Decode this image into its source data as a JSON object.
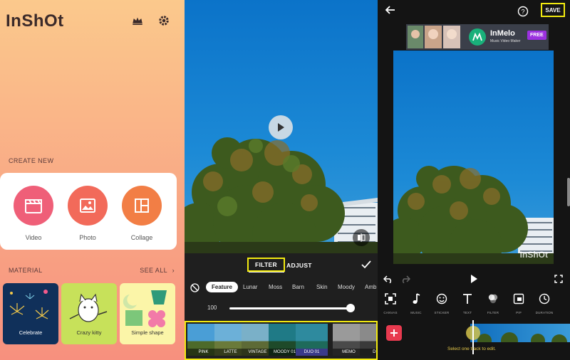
{
  "home": {
    "logo": "InShOt",
    "create_new_title": "CREATE NEW",
    "create_items": [
      {
        "label": "Video",
        "icon": "clapperboard-icon"
      },
      {
        "label": "Photo",
        "icon": "image-icon"
      },
      {
        "label": "Collage",
        "icon": "collage-icon"
      }
    ],
    "material_title": "MATERIAL",
    "see_all": "SEE ALL",
    "materials": [
      {
        "label": "Celebrate"
      },
      {
        "label": "Crazy kitty"
      },
      {
        "label": "Simple shape"
      }
    ]
  },
  "filter_editor": {
    "tabs": [
      "FILTER",
      "ADJUST"
    ],
    "categories": [
      "Feature",
      "Lunar",
      "Moss",
      "Barn",
      "Skin",
      "Moody",
      "Amb"
    ],
    "intensity": "100",
    "intensity_fraction": 1.0,
    "filters": [
      "PINK",
      "LATTE",
      "VINTAGE",
      "MOODY 01",
      "DUO 01",
      "MEMO",
      "DN"
    ]
  },
  "main_editor": {
    "save_label": "SAVE",
    "ad": {
      "title": "InMelo",
      "subtitle": "Music Video Maker",
      "badge": "FREE"
    },
    "watermark": "InShOt",
    "tools": [
      "CANVAS",
      "MUSIC",
      "STICKER",
      "TEXT",
      "FILTER",
      "PIP",
      "DURATION"
    ],
    "timeline_hint": "Select one track to edit."
  },
  "colors": {
    "highlight": "#f2ea10",
    "video_btn": "#ef5f78",
    "photo_btn": "#f26a5a",
    "collage_btn": "#f27e45",
    "add_btn": "#e83a4f"
  }
}
